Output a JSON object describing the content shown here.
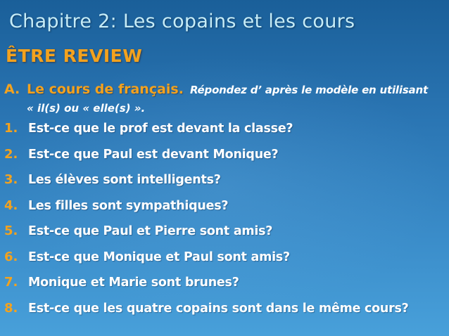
{
  "slide": {
    "title": "Chapitre 2: Les copains et les cours",
    "subtitle": "ÊTRE REVIEW",
    "section": {
      "letter": "A.",
      "heading": "Le cours de français.",
      "instruction_line1": "Répondez d’ après le modèle en utilisant",
      "instruction_line2": "« il(s) ou « elle(s) »."
    },
    "questions": [
      {
        "number": "1.",
        "text": "Est-ce que le prof est devant la classe?"
      },
      {
        "number": "2.",
        "text": "Est-ce que Paul est devant Monique?"
      },
      {
        "number": "3.",
        "text": "Les élèves sont intelligents?"
      },
      {
        "number": "4.",
        "text": "Les filles sont sympathiques?"
      },
      {
        "number": "5.",
        "text": "Est-ce que Paul et Pierre sont amis?"
      },
      {
        "number": "6.",
        "text": "Est-ce que Monique et Paul sont amis?"
      },
      {
        "number": "7.",
        "text": "Monique et Marie sont brunes?"
      },
      {
        "number": "8.",
        "text": "Est-ce que les quatre copains sont dans le même cours?"
      }
    ]
  },
  "colors": {
    "background_top": "#1a5f99",
    "background_bottom": "#48a0da",
    "title": "#c6ecf7",
    "accent": "#f3a21e",
    "text": "#ffffff"
  }
}
